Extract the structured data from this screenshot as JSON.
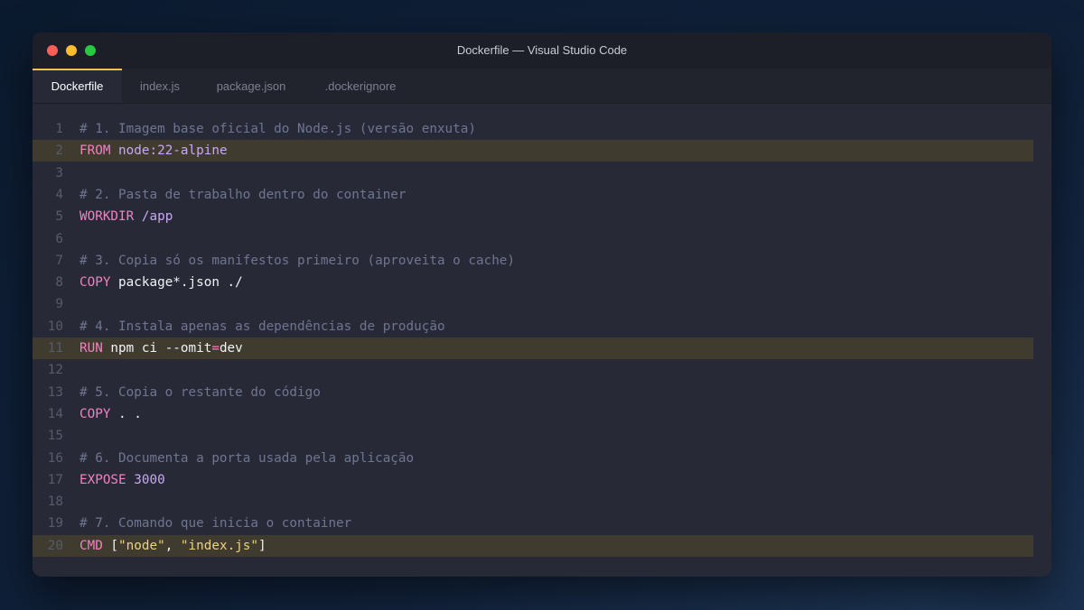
{
  "window": {
    "title": "Dockerfile — Visual Studio Code",
    "traffic_lights": [
      {
        "name": "close",
        "color": "#ff5f57"
      },
      {
        "name": "minimize",
        "color": "#febc2e"
      },
      {
        "name": "zoom",
        "color": "#28c840"
      }
    ]
  },
  "tabs": [
    {
      "label": "Dockerfile",
      "active": true
    },
    {
      "label": "index.js",
      "active": false
    },
    {
      "label": "package.json",
      "active": false
    },
    {
      "label": ".dockerignore",
      "active": false
    }
  ],
  "editor": {
    "highlighted_lines": [
      2,
      11,
      20
    ],
    "lines": [
      {
        "n": "1",
        "tokens": [
          {
            "t": "# 1. Imagem base oficial do Node.js (versão enxuta)",
            "c": "c"
          }
        ]
      },
      {
        "n": "2",
        "tokens": [
          {
            "t": "FROM",
            "c": "k"
          },
          {
            "t": " node:22-alpine",
            "c": "v"
          }
        ]
      },
      {
        "n": "3",
        "tokens": []
      },
      {
        "n": "4",
        "tokens": [
          {
            "t": "# 2. Pasta de trabalho dentro do container",
            "c": "c"
          }
        ]
      },
      {
        "n": "5",
        "tokens": [
          {
            "t": "WORKDIR",
            "c": "k"
          },
          {
            "t": " /app",
            "c": "v"
          }
        ]
      },
      {
        "n": "6",
        "tokens": []
      },
      {
        "n": "7",
        "tokens": [
          {
            "t": "# 3. Copia só os manifestos primeiro (aproveita o cache)",
            "c": "c"
          }
        ]
      },
      {
        "n": "8",
        "tokens": [
          {
            "t": "COPY",
            "c": "k"
          },
          {
            "t": " package*.json ./",
            "c": "t"
          }
        ]
      },
      {
        "n": "9",
        "tokens": []
      },
      {
        "n": "10",
        "tokens": [
          {
            "t": "# 4. Instala apenas as dependências de produção",
            "c": "c"
          }
        ]
      },
      {
        "n": "11",
        "tokens": [
          {
            "t": "RUN",
            "c": "k"
          },
          {
            "t": " npm ci --omit",
            "c": "t"
          },
          {
            "t": "=",
            "c": "p"
          },
          {
            "t": "dev",
            "c": "t"
          }
        ]
      },
      {
        "n": "12",
        "tokens": []
      },
      {
        "n": "13",
        "tokens": [
          {
            "t": "# 5. Copia o restante do código",
            "c": "c"
          }
        ]
      },
      {
        "n": "14",
        "tokens": [
          {
            "t": "COPY",
            "c": "k"
          },
          {
            "t": " . .",
            "c": "t"
          }
        ]
      },
      {
        "n": "15",
        "tokens": []
      },
      {
        "n": "16",
        "tokens": [
          {
            "t": "# 6. Documenta a porta usada pela aplicação",
            "c": "c"
          }
        ]
      },
      {
        "n": "17",
        "tokens": [
          {
            "t": "EXPOSE",
            "c": "k"
          },
          {
            "t": " 3000",
            "c": "v"
          }
        ]
      },
      {
        "n": "18",
        "tokens": []
      },
      {
        "n": "19",
        "tokens": [
          {
            "t": "# 7. Comando que inicia o container",
            "c": "c"
          }
        ]
      },
      {
        "n": "20",
        "tokens": [
          {
            "t": "CMD",
            "c": "k"
          },
          {
            "t": " [",
            "c": "t"
          },
          {
            "t": "\"node\"",
            "c": "s"
          },
          {
            "t": ", ",
            "c": "t"
          },
          {
            "t": "\"index.js\"",
            "c": "s"
          },
          {
            "t": "]",
            "c": "t"
          }
        ]
      }
    ]
  }
}
